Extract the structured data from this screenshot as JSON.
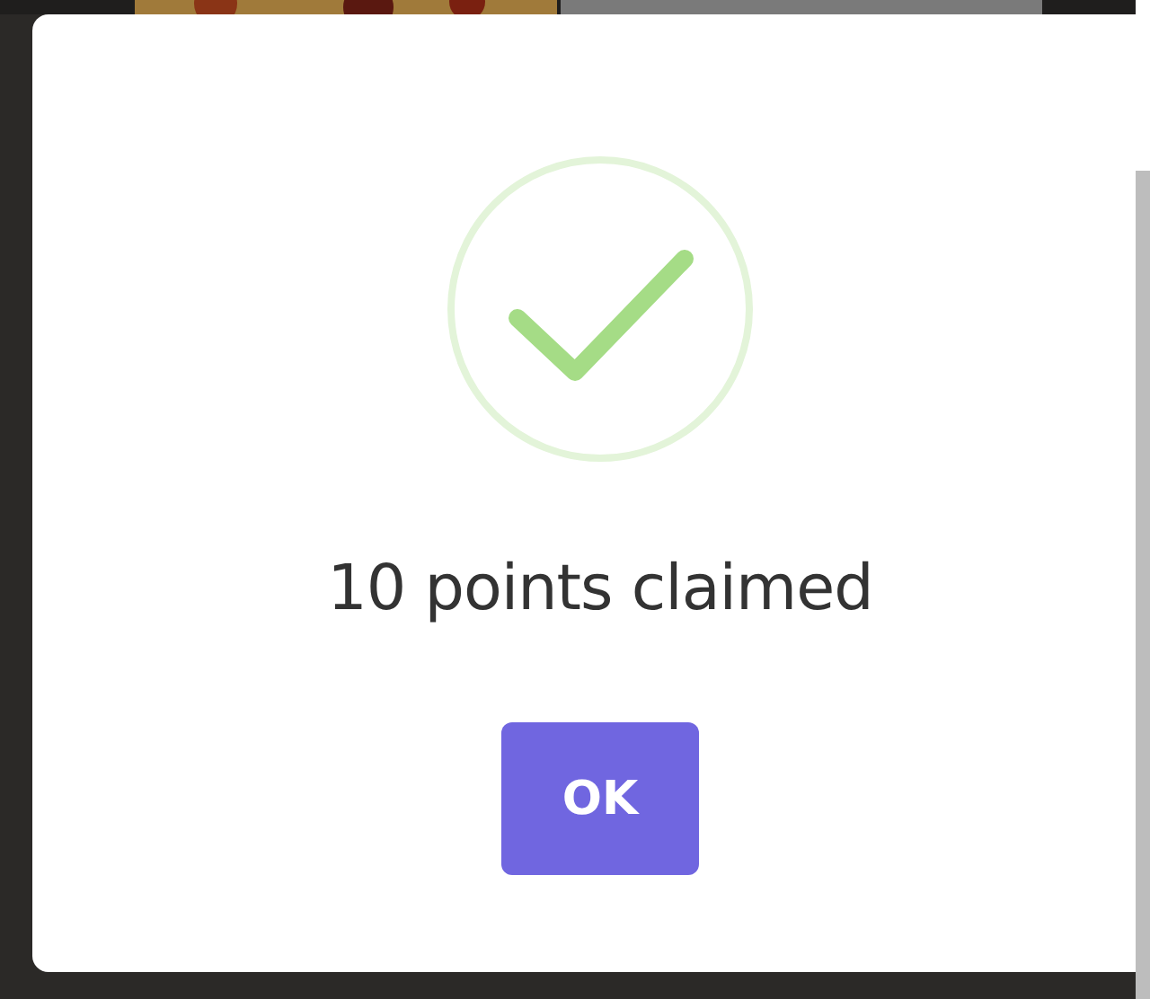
{
  "dialog": {
    "icon": {
      "kind": "success"
    },
    "title": "10 points claimed",
    "buttons": [
      {
        "label": "OK"
      }
    ]
  }
}
